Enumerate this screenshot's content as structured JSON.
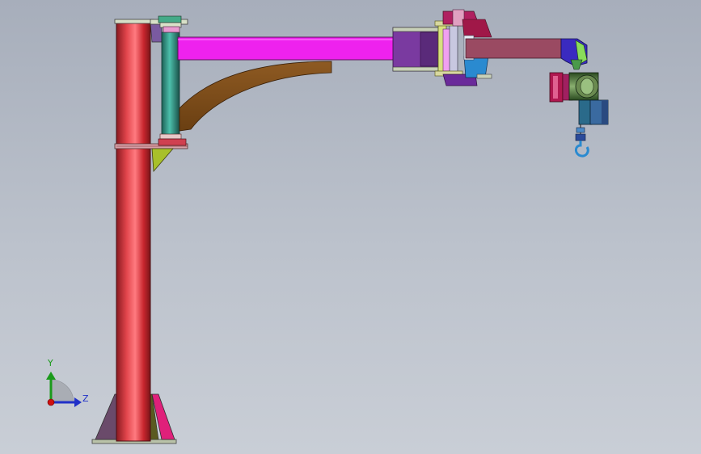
{
  "triad": {
    "y_label": "Y",
    "z_label": "Z",
    "colors": {
      "y": "#1a9a1a",
      "z": "#2030c8",
      "x": "#d01010"
    }
  },
  "colors": {
    "background_top": "#a7aebb",
    "background_bottom": "#c9ced6",
    "pillar": "#d0333a",
    "boom": "#ee22ee",
    "strut": "#7a4a1a",
    "pivot_shaft": "#2a8a7a",
    "arm2": "#9a4a62",
    "hoist": "#2a6a8a"
  }
}
